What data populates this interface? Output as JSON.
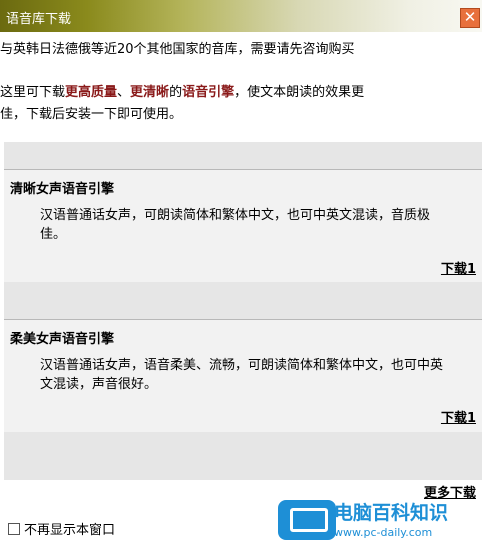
{
  "window": {
    "title": "语音库下载",
    "close_glyph": "✕"
  },
  "intro": {
    "line1": "与英韩日法德俄等近20个其他国家的音库，需要请先咨询购买",
    "line2_parts": [
      "这里可下载",
      "更高质量",
      "、",
      "更清晰",
      "的",
      "语音引擎",
      "，使文本朗读的效果更"
    ],
    "line3": "佳，下载后安装一下即可使用。"
  },
  "engines": [
    {
      "title": "清晰女声语音引擎",
      "description": "汉语普通话女声，可朗读简体和繁体中文，也可中英文混读，音质极佳。",
      "download_label": "下载1"
    },
    {
      "title": "柔美女声语音引擎",
      "description": "汉语普通话女声，语音柔美、流畅，可朗读简体和繁体中文，也可中英文混读，声音很好。",
      "download_label": "下载1"
    }
  ],
  "more_download_label": "更多下载",
  "footer": {
    "checkbox_checked": false,
    "checkbox_label": "不再显示本窗口"
  },
  "watermark": {
    "icon": "monitor-icon",
    "name": "电脑百科知识",
    "url": "www.pc-daily.com"
  },
  "colors": {
    "highlight_text": "#8a1a1a",
    "section_bg": "#f2f2f2",
    "close_button": "#e8703c",
    "watermark_blue": "#1e8fd6"
  }
}
